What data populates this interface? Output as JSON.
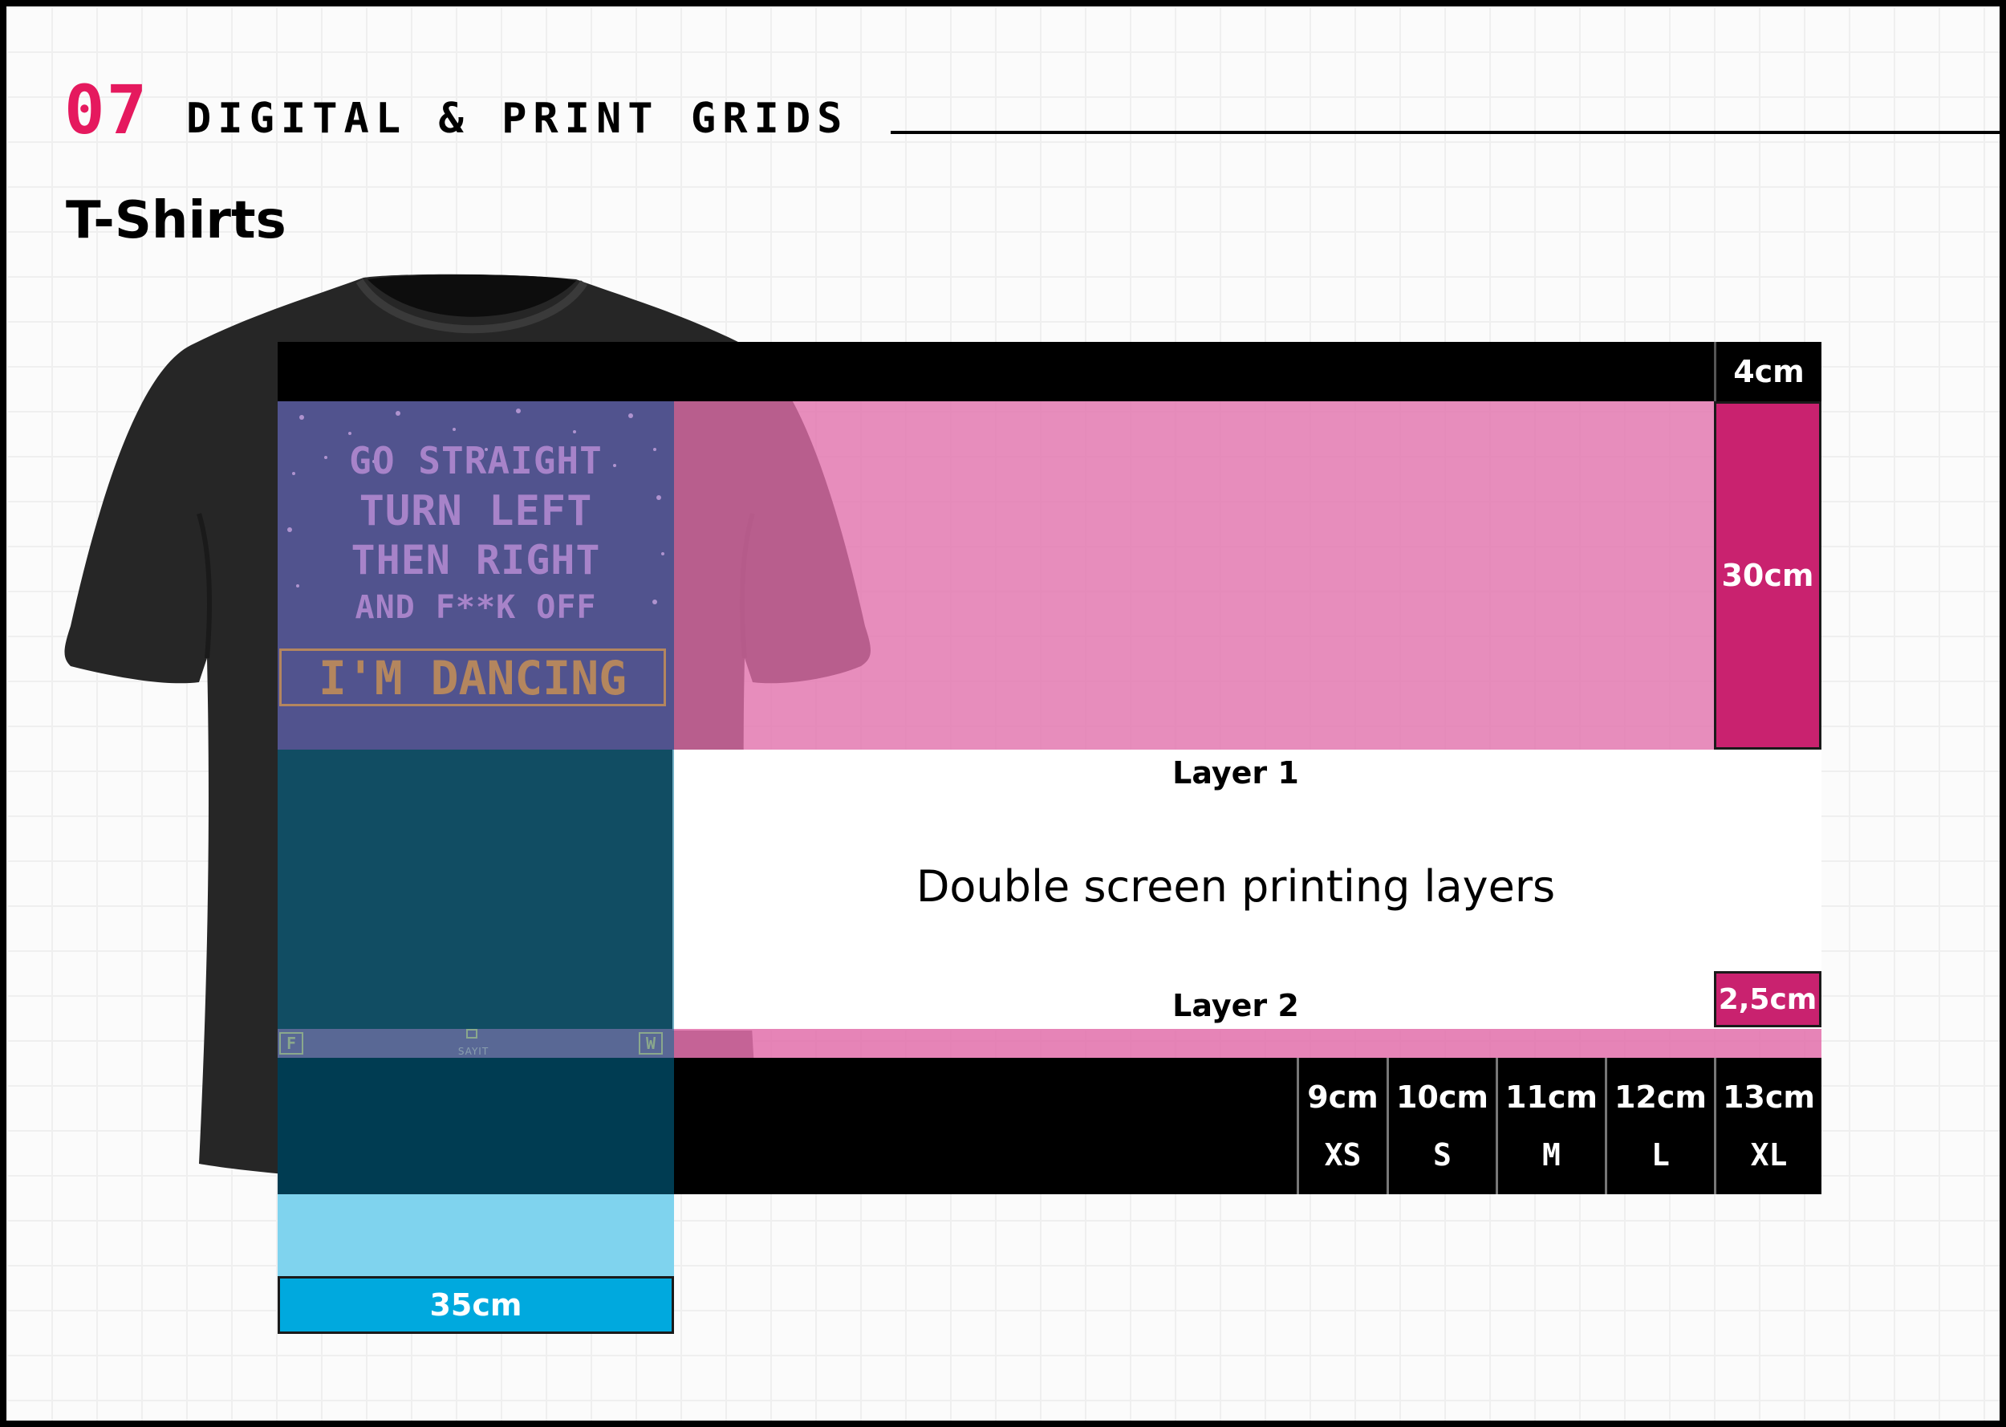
{
  "section": {
    "number": "07",
    "title": "DIGITAL & PRINT GRIDS"
  },
  "subtitle": "T-Shirts",
  "design": {
    "lines": [
      "GO STRAIGHT",
      "TURN LEFT",
      "THEN RIGHT",
      "AND F**K OFF"
    ],
    "badge": "I'M DANCING",
    "tag_left": "F",
    "tag_right": "W",
    "brand": "SAYIT"
  },
  "dimensions": {
    "top_margin": "4cm",
    "layer1_height": "30cm",
    "layer2_height": "2,5cm",
    "print_width": "35cm"
  },
  "labels": {
    "layer1": "Layer 1",
    "layer2": "Layer 2",
    "caption": "Double screen printing layers"
  },
  "sizes": [
    {
      "width": "9cm",
      "size": "XS"
    },
    {
      "width": "10cm",
      "size": "S"
    },
    {
      "width": "11cm",
      "size": "M"
    },
    {
      "width": "12cm",
      "size": "L"
    },
    {
      "width": "13cm",
      "size": "XL"
    }
  ],
  "colors": {
    "accent": "#e5195e",
    "layer_pink": "#e26eaa",
    "dimension_pink": "#c9226f",
    "dimension_blue": "#00a9de",
    "bar": "#000000"
  }
}
